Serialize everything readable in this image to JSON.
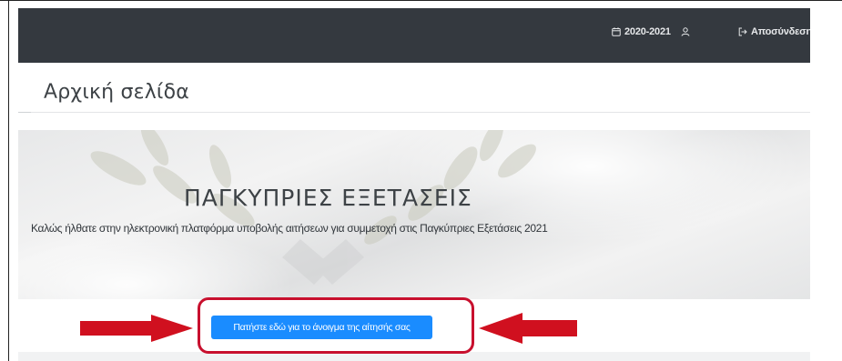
{
  "header": {
    "year_label": "2020-2021",
    "logout_label": "Αποσύνδεση",
    "icons": [
      "calendar-icon",
      "user-icon",
      "logout-icon"
    ]
  },
  "page": {
    "title": "Αρχική σελίδα"
  },
  "hero": {
    "heading": "ΠΑΓΚΥΠΡΙΕΣ ΕΞΕΤΑΣΕΙΣ",
    "subtitle": "Καλώς ήλθατε στην ηλεκτρονική πλατφόρμα υποβολής αιτήσεων για συμμετοχή στις Παγκύπριες Εξετάσεις 2021"
  },
  "cta": {
    "button_label": "Πατήστε εδώ για το άνοιγμα της αίτησής σας"
  },
  "colors": {
    "header_bg": "#34393f",
    "button_bg": "#1a8cff",
    "annotation_red": "#c8102e"
  }
}
